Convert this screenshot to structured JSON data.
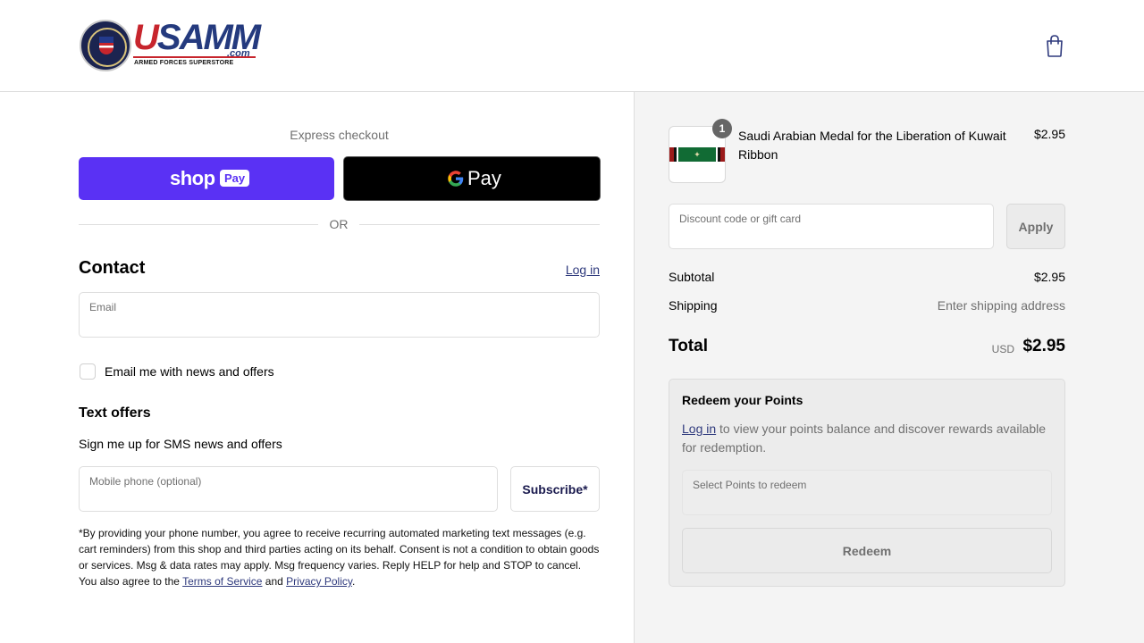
{
  "header": {
    "logo_text_u": "U",
    "logo_text_rest": "SAMM",
    "logo_com": ".com",
    "logo_tagline": "ARMED FORCES SUPERSTORE",
    "cart_icon": "shopping-bag-icon"
  },
  "express": {
    "label": "Express checkout",
    "shop_pay_text": "shop",
    "shop_pay_badge": "Pay",
    "google_pay_g": "G",
    "google_pay_text": "Pay",
    "or_text": "OR"
  },
  "contact": {
    "title": "Contact",
    "login_link": "Log in",
    "email_label": "Email",
    "email_value": "",
    "newsletter_label": "Email me with news and offers"
  },
  "text_offers": {
    "title": "Text offers",
    "sms_label": "Sign me up for SMS news and offers",
    "phone_label": "Mobile phone (optional)",
    "phone_value": "",
    "subscribe_button": "Subscribe*",
    "disclaimer_text": "*By providing your phone number, you agree to receive recurring automated marketing text messages (e.g. cart reminders) from this shop and third parties acting on its behalf. Consent is not a condition to obtain goods or services. Msg & data rates may apply. Msg frequency varies. Reply HELP for help and STOP to cancel. You also agree to the ",
    "terms_link": "Terms of Service",
    "and_text": " and ",
    "privacy_link": "Privacy Policy",
    "end_text": "."
  },
  "summary": {
    "product": {
      "name": "Saudi Arabian Medal for the Liberation of Kuwait Ribbon",
      "price": "$2.95",
      "quantity": "1"
    },
    "discount_label": "Discount code or gift card",
    "discount_value": "",
    "apply_button": "Apply",
    "subtotal_label": "Subtotal",
    "subtotal_value": "$2.95",
    "shipping_label": "Shipping",
    "shipping_value": "Enter shipping address",
    "total_label": "Total",
    "total_currency": "USD",
    "total_value": "$2.95"
  },
  "points": {
    "title": "Redeem your Points",
    "login_link": "Log in",
    "description": " to view your points balance and discover rewards available for redemption.",
    "select_label": "Select Points to redeem",
    "select_value": "",
    "redeem_button": "Redeem"
  },
  "colors": {
    "shop_pay": "#5a31f4",
    "link": "#2f3a7d",
    "summary_bg": "#f4f4f4"
  }
}
